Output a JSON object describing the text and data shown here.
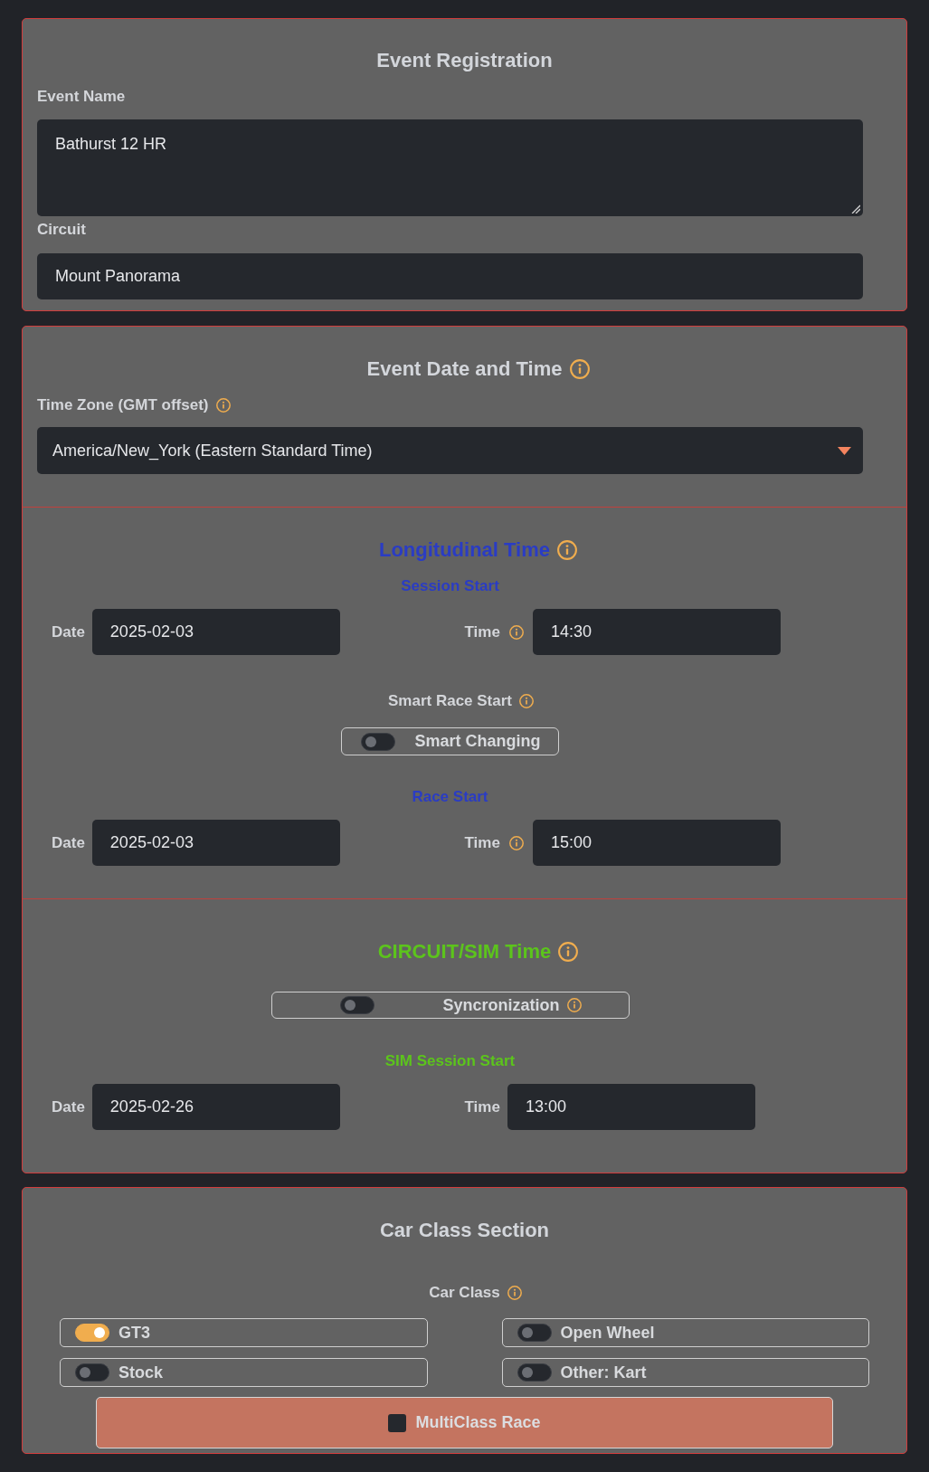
{
  "registration": {
    "title": "Event Registration",
    "fields": [
      {
        "kind": "textarea",
        "label": "Event Name",
        "value": "Bathurst 12 HR"
      },
      {
        "kind": "input",
        "label": "Circuit",
        "value": "Mount Panorama"
      }
    ]
  },
  "date_time": {
    "title": "Event Date and Time",
    "info": true,
    "time_zone": {
      "label": "Time Zone (GMT offset)",
      "info": true,
      "value": "America/New_York (Eastern Standard Time)"
    }
  },
  "longitudinal_time": {
    "title": "Longitudinal Time",
    "info": true,
    "session_start": {
      "heading": "Session Start",
      "date_label": "Date",
      "date": "2025-02-03",
      "time_label": "Time",
      "time_info": true,
      "time": "14:30"
    },
    "smart_race_start": {
      "label": "Smart Race Start",
      "info": true,
      "switch": {
        "label": "Smart Changing",
        "on": false
      }
    },
    "race_start": {
      "heading": "Race Start",
      "date_label": "Date",
      "date": "2025-02-03",
      "time_label": "Time",
      "time_info": true,
      "time": "15:00"
    }
  },
  "circuit_sim_time": {
    "title": "CIRCUIT/SIM Time",
    "info": true,
    "sync": {
      "label": "Syncronization",
      "info": true,
      "on": false
    },
    "sim_session_start": {
      "heading": "SIM Session Start",
      "date_label": "Date",
      "date": "2025-02-26",
      "time_label": "Time",
      "time_info": false,
      "time": "13:00"
    }
  },
  "car_class": {
    "title": "Car Class Section",
    "label": "Car Class",
    "info": true,
    "classes": [
      {
        "label": "GT3",
        "on": true
      },
      {
        "label": "Open Wheel",
        "on": false
      },
      {
        "label": "Stock",
        "on": false
      },
      {
        "label": "Other: Kart",
        "on": false
      }
    ],
    "multiclass": {
      "label": "MultiClass Race",
      "checked": false
    }
  }
}
